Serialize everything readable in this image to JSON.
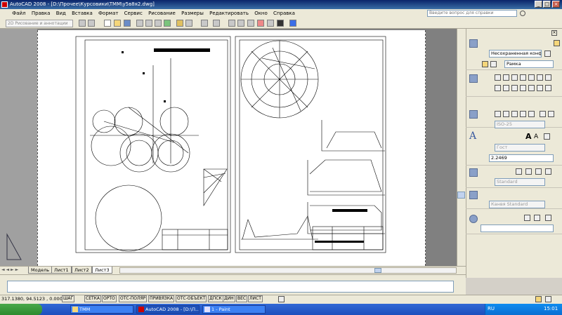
{
  "window": {
    "title": "AutoCAD 2008 - [D:\\Прочее\\Курсовики\\ТММ\\у5в8я2.dwg]",
    "min": "_",
    "max": "□",
    "close": "×"
  },
  "menu": [
    "Файл",
    "Правка",
    "Вид",
    "Вставка",
    "Формат",
    "Сервис",
    "Рисование",
    "Размеры",
    "Редактировать",
    "Окно",
    "Справка"
  ],
  "help_search": {
    "placeholder": "Введите вопрос для справки"
  },
  "workspace": {
    "value": "2D Рисование и аннотации"
  },
  "layout_tabs": [
    {
      "label": "Модель"
    },
    {
      "label": "Лист1"
    },
    {
      "label": "Лист2"
    },
    {
      "label": "Лист3",
      "active": true
    }
  ],
  "palette": {
    "layer_state": "Несохраненная конфигу",
    "layer": "Рамка",
    "dim_style": "ISO-25",
    "text_style": "Гост",
    "text_height": "2.2469",
    "table_style": "Standard",
    "multileader_style": "Канвя Standard"
  },
  "status": {
    "coords": "317.1380, 94.5123 , 0.0000",
    "buttons": [
      "ШАГ",
      "СЕТКА",
      "ОРТО",
      "ОТС-ПОЛЯР",
      "ПРИВЯЗКА",
      "ОТС-ОБЪЕКТ",
      "ДПСК",
      "ДИН",
      "ВЕС",
      "ЛИСТ"
    ]
  },
  "taskbar": {
    "tasks": [
      {
        "label": "ТММ",
        "icon": "folder-icon"
      },
      {
        "label": "AutoCAD 2008 - [D:\\П...",
        "icon": "autocad-icon",
        "active": true
      },
      {
        "label": "1 - Paint",
        "icon": "paint-icon"
      }
    ],
    "lang": "RU",
    "clock": "15:01"
  },
  "colors": {
    "titlebar": "#0a246a",
    "taskbar": "#245edb",
    "start": "#3c9a3c",
    "palette_bg": "#ece9d8"
  }
}
